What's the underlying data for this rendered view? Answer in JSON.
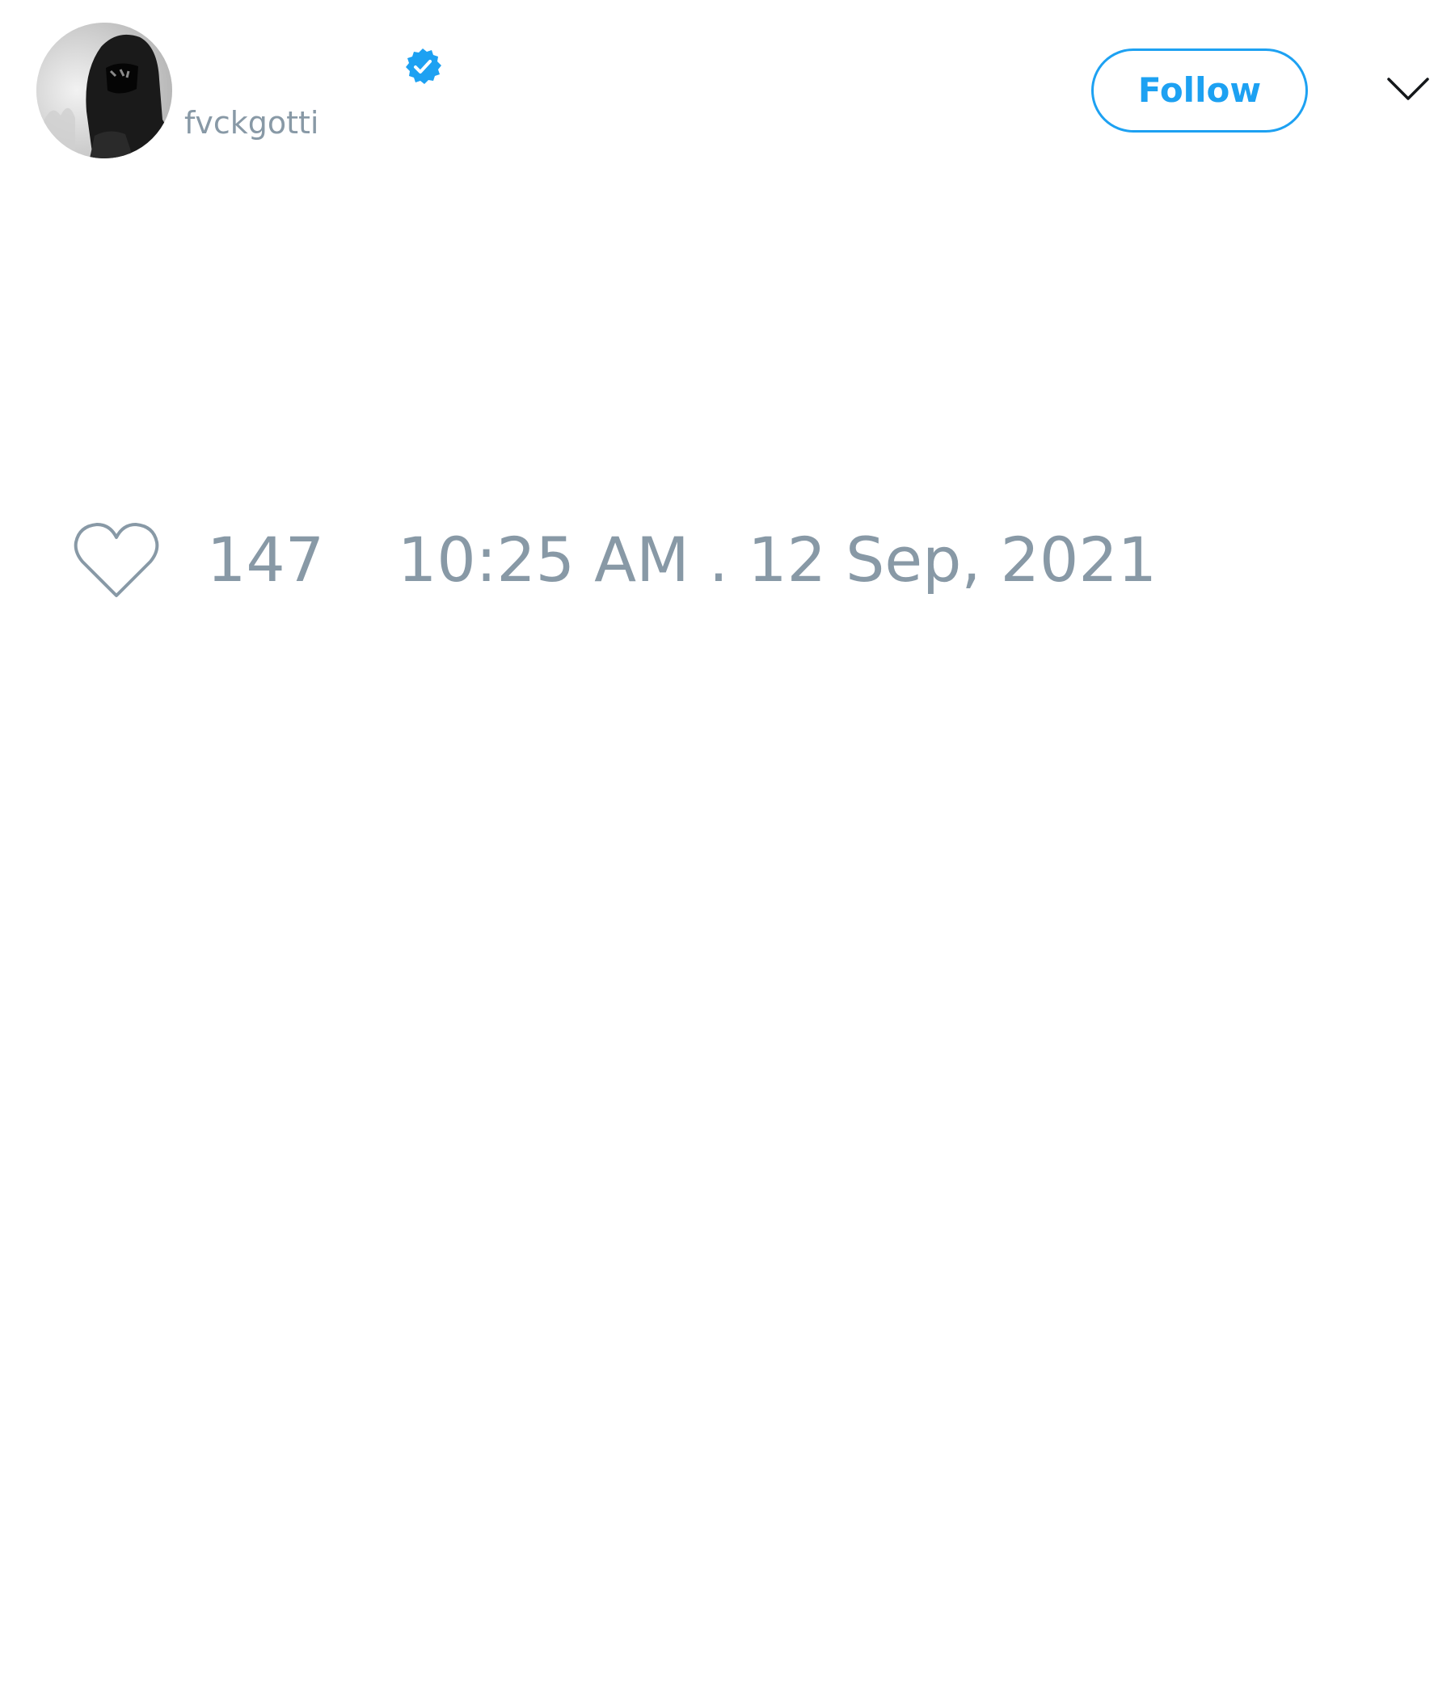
{
  "tweet": {
    "author": {
      "display_name": "",
      "username": "fvckgotti",
      "verified": true,
      "avatar_icon": "hooded-figure-avatar"
    },
    "follow_button": {
      "label": "Follow"
    },
    "menu_icon": "chevron-down-icon",
    "likes": {
      "icon": "heart-icon",
      "count": "147"
    },
    "timestamp": "10:25 AM . 12 Sep, 2021"
  },
  "colors": {
    "accent": "#1da1f2",
    "muted_text": "#8899a6",
    "background": "#ffffff"
  }
}
